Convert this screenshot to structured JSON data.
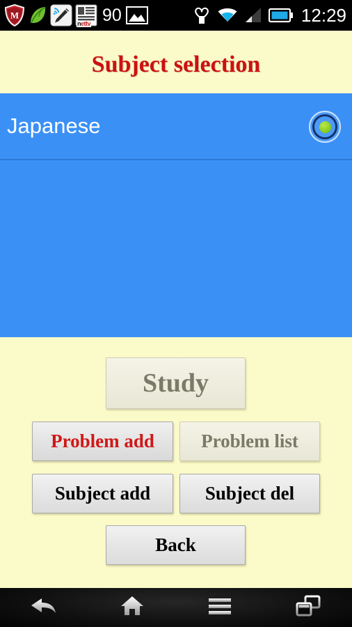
{
  "statusbar": {
    "left_icons": [
      {
        "name": "mcafee-shield-icon",
        "label": "M"
      },
      {
        "name": "leaf-icon",
        "label": ""
      },
      {
        "name": "stylus-pen-icon",
        "label": ""
      },
      {
        "name": "nettv-news-icon",
        "label_part1": "n",
        "label_part2": "e",
        "label_part3": "ttv"
      }
    ],
    "battery_percent": "90",
    "gallery_icon": "image-photo-icon",
    "right_icons": [
      {
        "name": "heart-health-icon"
      },
      {
        "name": "wifi-icon"
      },
      {
        "name": "cellular-signal-icon"
      },
      {
        "name": "battery-icon"
      }
    ],
    "clock": "12:29"
  },
  "header": {
    "title": "Subject selection"
  },
  "subject_list": {
    "items": [
      {
        "label": "Japanese",
        "selected": true
      }
    ]
  },
  "actions": {
    "study": {
      "label": "Study",
      "enabled": false
    },
    "problem_add": {
      "label": "Problem add",
      "enabled": true
    },
    "problem_list": {
      "label": "Problem list",
      "enabled": false
    },
    "subject_add": {
      "label": "Subject add",
      "enabled": true
    },
    "subject_del": {
      "label": "Subject del",
      "enabled": true
    },
    "back": {
      "label": "Back",
      "enabled": true
    }
  },
  "navbar": {
    "buttons": [
      {
        "name": "nav-back-button",
        "icon": "back-arrow-icon"
      },
      {
        "name": "nav-home-button",
        "icon": "home-icon"
      },
      {
        "name": "nav-menu-button",
        "icon": "menu-hamburger-icon"
      },
      {
        "name": "nav-recents-button",
        "icon": "recent-apps-icon"
      }
    ]
  },
  "colors": {
    "background": "#fbfac9",
    "list_blue": "#3b90f6",
    "title_red": "#cc1111",
    "accent_green": "#8cd31a",
    "red_label": "#d01818"
  }
}
